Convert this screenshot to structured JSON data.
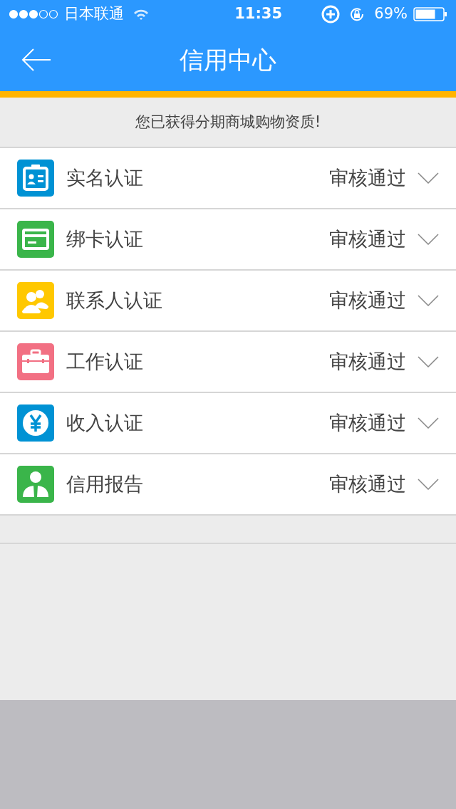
{
  "status_bar": {
    "carrier": "日本联通",
    "time": "11:35",
    "battery": "69%"
  },
  "header": {
    "title": "信用中心"
  },
  "notice": "您已获得分期商城购物资质!",
  "items": [
    {
      "kind": "id-card",
      "color": "#0092d4",
      "label": "实名认证",
      "status": "审核通过"
    },
    {
      "kind": "card",
      "color": "#3ab54a",
      "label": "绑卡认证",
      "status": "审核通过"
    },
    {
      "kind": "contacts",
      "color": "#ffc800",
      "label": "联系人认证",
      "status": "审核通过"
    },
    {
      "kind": "briefcase",
      "color": "#f27083",
      "label": "工作认证",
      "status": "审核通过"
    },
    {
      "kind": "yen",
      "color": "#0092d4",
      "label": "收入认证",
      "status": "审核通过"
    },
    {
      "kind": "person",
      "color": "#3ab54a",
      "label": "信用报告",
      "status": "审核通过"
    }
  ]
}
